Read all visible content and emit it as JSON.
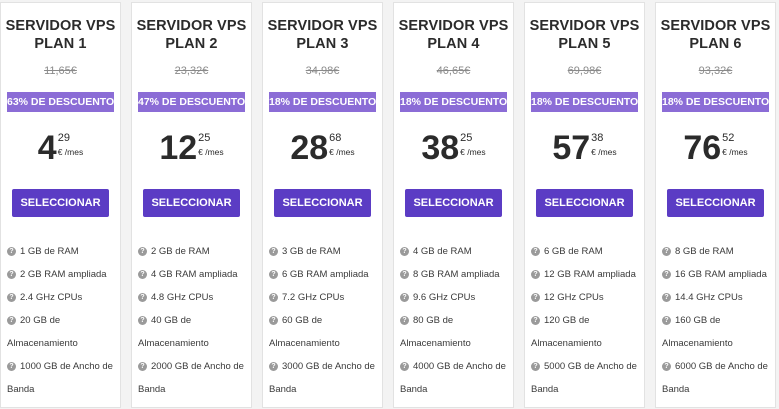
{
  "plans": [
    {
      "title_line1": "SERVIDOR VPS",
      "title_line2": "PLAN 1",
      "old_price": "11,65€",
      "discount": "63% DE DESCUENTO",
      "price_int": "4",
      "price_cents": "29",
      "price_unit": "€ /mes",
      "button": "SELECCIONAR",
      "features": [
        "1 GB de RAM",
        "2 GB RAM ampliada",
        "2.4 GHz CPUs",
        "20 GB de Almacenamiento",
        "1000 GB de Ancho de Banda"
      ]
    },
    {
      "title_line1": "SERVIDOR VPS",
      "title_line2": "PLAN 2",
      "old_price": "23,32€",
      "discount": "47% DE DESCUENTO",
      "price_int": "12",
      "price_cents": "25",
      "price_unit": "€ /mes",
      "button": "SELECCIONAR",
      "features": [
        "2 GB de RAM",
        "4 GB RAM ampliada",
        "4.8 GHz CPUs",
        "40 GB de Almacenamiento",
        "2000 GB de Ancho de Banda"
      ]
    },
    {
      "title_line1": "SERVIDOR VPS",
      "title_line2": "PLAN 3",
      "old_price": "34,98€",
      "discount": "18% DE DESCUENTO",
      "price_int": "28",
      "price_cents": "68",
      "price_unit": "€ /mes",
      "button": "SELECCIONAR",
      "features": [
        "3 GB de RAM",
        "6 GB RAM ampliada",
        "7.2 GHz CPUs",
        "60 GB de Almacenamiento",
        "3000 GB de Ancho de Banda"
      ]
    },
    {
      "title_line1": "SERVIDOR VPS",
      "title_line2": "PLAN 4",
      "old_price": "46,65€",
      "discount": "18% DE DESCUENTO",
      "price_int": "38",
      "price_cents": "25",
      "price_unit": "€ /mes",
      "button": "SELECCIONAR",
      "features": [
        "4 GB de RAM",
        "8 GB RAM ampliada",
        "9.6 GHz CPUs",
        "80 GB de Almacenamiento",
        "4000 GB de Ancho de Banda"
      ]
    },
    {
      "title_line1": "SERVIDOR VPS",
      "title_line2": "PLAN 5",
      "old_price": "69,98€",
      "discount": "18% DE DESCUENTO",
      "price_int": "57",
      "price_cents": "38",
      "price_unit": "€ /mes",
      "button": "SELECCIONAR",
      "features": [
        "6 GB de RAM",
        "12 GB RAM ampliada",
        "12 GHz CPUs",
        "120 GB de Almacenamiento",
        "5000 GB de Ancho de Banda"
      ]
    },
    {
      "title_line1": "SERVIDOR VPS",
      "title_line2": "PLAN 6",
      "old_price": "93,32€",
      "discount": "18% DE DESCUENTO",
      "price_int": "76",
      "price_cents": "52",
      "price_unit": "€ /mes",
      "button": "SELECCIONAR",
      "features": [
        "8 GB de RAM",
        "16 GB RAM ampliada",
        "14.4 GHz CPUs",
        "160 GB de Almacenamiento",
        "6000 GB de Ancho de Banda"
      ]
    }
  ],
  "icons": {
    "feature_icon": "question-circle-icon",
    "feature_icon_glyph": "?"
  },
  "colors": {
    "button_bg": "#5b3cc4",
    "discount_bg": "#8b6cd6",
    "card_bg": "#ffffff",
    "page_bg": "#f3f3f3"
  }
}
